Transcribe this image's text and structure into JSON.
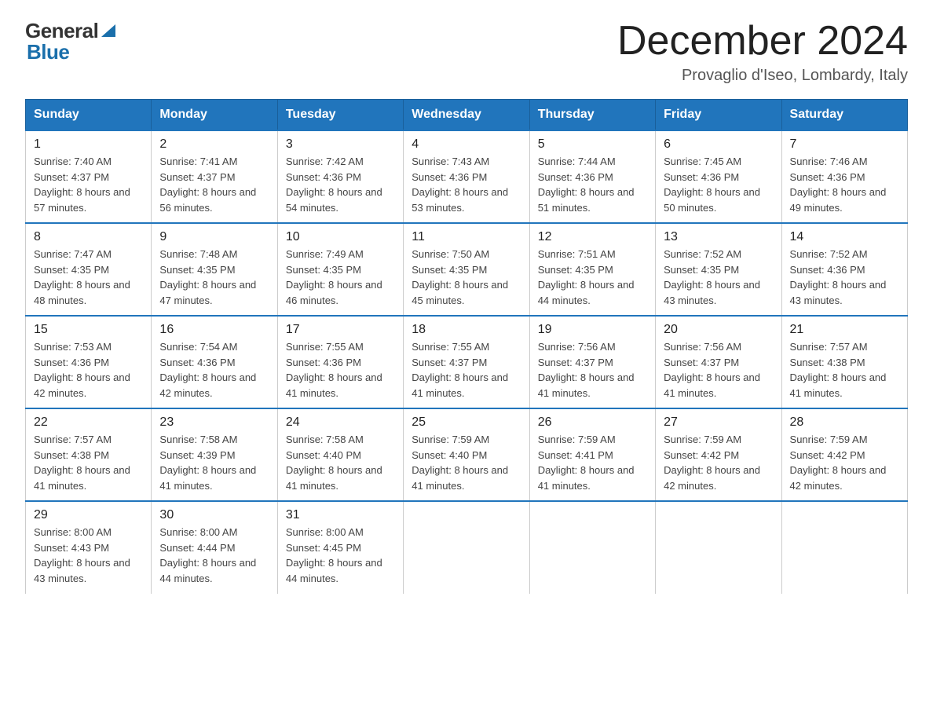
{
  "logo": {
    "general": "General",
    "blue": "Blue"
  },
  "title": "December 2024",
  "location": "Provaglio d'Iseo, Lombardy, Italy",
  "headers": [
    "Sunday",
    "Monday",
    "Tuesday",
    "Wednesday",
    "Thursday",
    "Friday",
    "Saturday"
  ],
  "weeks": [
    [
      {
        "day": "1",
        "sunrise": "7:40 AM",
        "sunset": "4:37 PM",
        "daylight": "8 hours and 57 minutes."
      },
      {
        "day": "2",
        "sunrise": "7:41 AM",
        "sunset": "4:37 PM",
        "daylight": "8 hours and 56 minutes."
      },
      {
        "day": "3",
        "sunrise": "7:42 AM",
        "sunset": "4:36 PM",
        "daylight": "8 hours and 54 minutes."
      },
      {
        "day": "4",
        "sunrise": "7:43 AM",
        "sunset": "4:36 PM",
        "daylight": "8 hours and 53 minutes."
      },
      {
        "day": "5",
        "sunrise": "7:44 AM",
        "sunset": "4:36 PM",
        "daylight": "8 hours and 51 minutes."
      },
      {
        "day": "6",
        "sunrise": "7:45 AM",
        "sunset": "4:36 PM",
        "daylight": "8 hours and 50 minutes."
      },
      {
        "day": "7",
        "sunrise": "7:46 AM",
        "sunset": "4:36 PM",
        "daylight": "8 hours and 49 minutes."
      }
    ],
    [
      {
        "day": "8",
        "sunrise": "7:47 AM",
        "sunset": "4:35 PM",
        "daylight": "8 hours and 48 minutes."
      },
      {
        "day": "9",
        "sunrise": "7:48 AM",
        "sunset": "4:35 PM",
        "daylight": "8 hours and 47 minutes."
      },
      {
        "day": "10",
        "sunrise": "7:49 AM",
        "sunset": "4:35 PM",
        "daylight": "8 hours and 46 minutes."
      },
      {
        "day": "11",
        "sunrise": "7:50 AM",
        "sunset": "4:35 PM",
        "daylight": "8 hours and 45 minutes."
      },
      {
        "day": "12",
        "sunrise": "7:51 AM",
        "sunset": "4:35 PM",
        "daylight": "8 hours and 44 minutes."
      },
      {
        "day": "13",
        "sunrise": "7:52 AM",
        "sunset": "4:35 PM",
        "daylight": "8 hours and 43 minutes."
      },
      {
        "day": "14",
        "sunrise": "7:52 AM",
        "sunset": "4:36 PM",
        "daylight": "8 hours and 43 minutes."
      }
    ],
    [
      {
        "day": "15",
        "sunrise": "7:53 AM",
        "sunset": "4:36 PM",
        "daylight": "8 hours and 42 minutes."
      },
      {
        "day": "16",
        "sunrise": "7:54 AM",
        "sunset": "4:36 PM",
        "daylight": "8 hours and 42 minutes."
      },
      {
        "day": "17",
        "sunrise": "7:55 AM",
        "sunset": "4:36 PM",
        "daylight": "8 hours and 41 minutes."
      },
      {
        "day": "18",
        "sunrise": "7:55 AM",
        "sunset": "4:37 PM",
        "daylight": "8 hours and 41 minutes."
      },
      {
        "day": "19",
        "sunrise": "7:56 AM",
        "sunset": "4:37 PM",
        "daylight": "8 hours and 41 minutes."
      },
      {
        "day": "20",
        "sunrise": "7:56 AM",
        "sunset": "4:37 PM",
        "daylight": "8 hours and 41 minutes."
      },
      {
        "day": "21",
        "sunrise": "7:57 AM",
        "sunset": "4:38 PM",
        "daylight": "8 hours and 41 minutes."
      }
    ],
    [
      {
        "day": "22",
        "sunrise": "7:57 AM",
        "sunset": "4:38 PM",
        "daylight": "8 hours and 41 minutes."
      },
      {
        "day": "23",
        "sunrise": "7:58 AM",
        "sunset": "4:39 PM",
        "daylight": "8 hours and 41 minutes."
      },
      {
        "day": "24",
        "sunrise": "7:58 AM",
        "sunset": "4:40 PM",
        "daylight": "8 hours and 41 minutes."
      },
      {
        "day": "25",
        "sunrise": "7:59 AM",
        "sunset": "4:40 PM",
        "daylight": "8 hours and 41 minutes."
      },
      {
        "day": "26",
        "sunrise": "7:59 AM",
        "sunset": "4:41 PM",
        "daylight": "8 hours and 41 minutes."
      },
      {
        "day": "27",
        "sunrise": "7:59 AM",
        "sunset": "4:42 PM",
        "daylight": "8 hours and 42 minutes."
      },
      {
        "day": "28",
        "sunrise": "7:59 AM",
        "sunset": "4:42 PM",
        "daylight": "8 hours and 42 minutes."
      }
    ],
    [
      {
        "day": "29",
        "sunrise": "8:00 AM",
        "sunset": "4:43 PM",
        "daylight": "8 hours and 43 minutes."
      },
      {
        "day": "30",
        "sunrise": "8:00 AM",
        "sunset": "4:44 PM",
        "daylight": "8 hours and 44 minutes."
      },
      {
        "day": "31",
        "sunrise": "8:00 AM",
        "sunset": "4:45 PM",
        "daylight": "8 hours and 44 minutes."
      },
      null,
      null,
      null,
      null
    ]
  ]
}
